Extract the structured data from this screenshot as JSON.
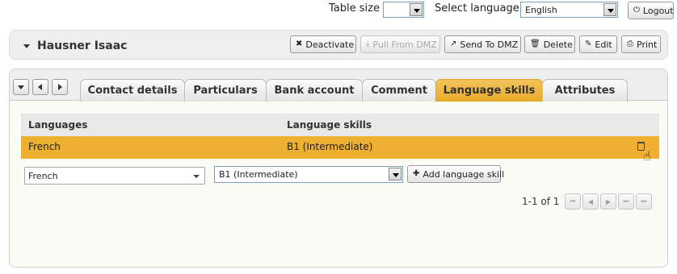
{
  "topbar": {
    "table_size_label": "Table size",
    "table_size_value": "",
    "language_label": "Select language:",
    "language_value": "English",
    "logout_label": "Logout"
  },
  "header": {
    "name": "Hausner Isaac",
    "buttons": {
      "deactivate": "Deactivate",
      "pull_from_dmz": "Pull From DMZ",
      "send_to_dmz": "Send To DMZ",
      "delete": "Delete",
      "edit": "Edit",
      "print": "Print"
    }
  },
  "tabs": [
    {
      "label": "Contact details",
      "active": false
    },
    {
      "label": "Particulars",
      "active": false
    },
    {
      "label": "Bank account",
      "active": false
    },
    {
      "label": "Comment",
      "active": false
    },
    {
      "label": "Language skills",
      "active": true
    },
    {
      "label": "Attributes",
      "active": false
    }
  ],
  "table": {
    "columns": [
      "Languages",
      "Language skills"
    ],
    "rows": [
      {
        "language": "French",
        "skill": "B1 (Intermediate)"
      }
    ]
  },
  "add_form": {
    "language_value": "French",
    "skill_value": "B1 (Intermediate)",
    "add_button": "Add language skill"
  },
  "pager": {
    "text": "1-1 of 1"
  },
  "colors": {
    "active_tab": "#e9aa2a",
    "selected_row": "#efb032"
  }
}
